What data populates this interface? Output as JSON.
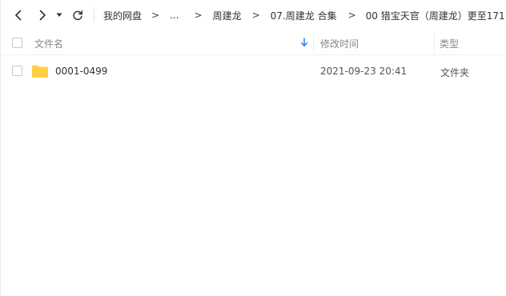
{
  "navbar": {
    "back_icon": "chevron-left-icon",
    "forward_icon": "chevron-right-icon",
    "history_icon": "caret-down-icon",
    "refresh_icon": "refresh-icon",
    "breadcrumb": [
      {
        "label": "我的网盘"
      },
      {
        "label": "..."
      },
      {
        "label": "周建龙"
      },
      {
        "label": "07.周建龙 合集"
      },
      {
        "label": "00 猎宝天官（周建龙）更至171"
      }
    ],
    "separator": ">"
  },
  "header": {
    "name_label": "文件名",
    "time_label": "修改时间",
    "type_label": "类型",
    "sort_icon": "sort-down-arrow-icon",
    "sort_color": "#2e88f0"
  },
  "files": [
    {
      "name": "0001-0499",
      "modified": "2021-09-23 20:41",
      "type": "文件夹",
      "icon": "folder-icon"
    }
  ],
  "colors": {
    "folder": "#ffd24c",
    "accent": "#2e88f0"
  }
}
